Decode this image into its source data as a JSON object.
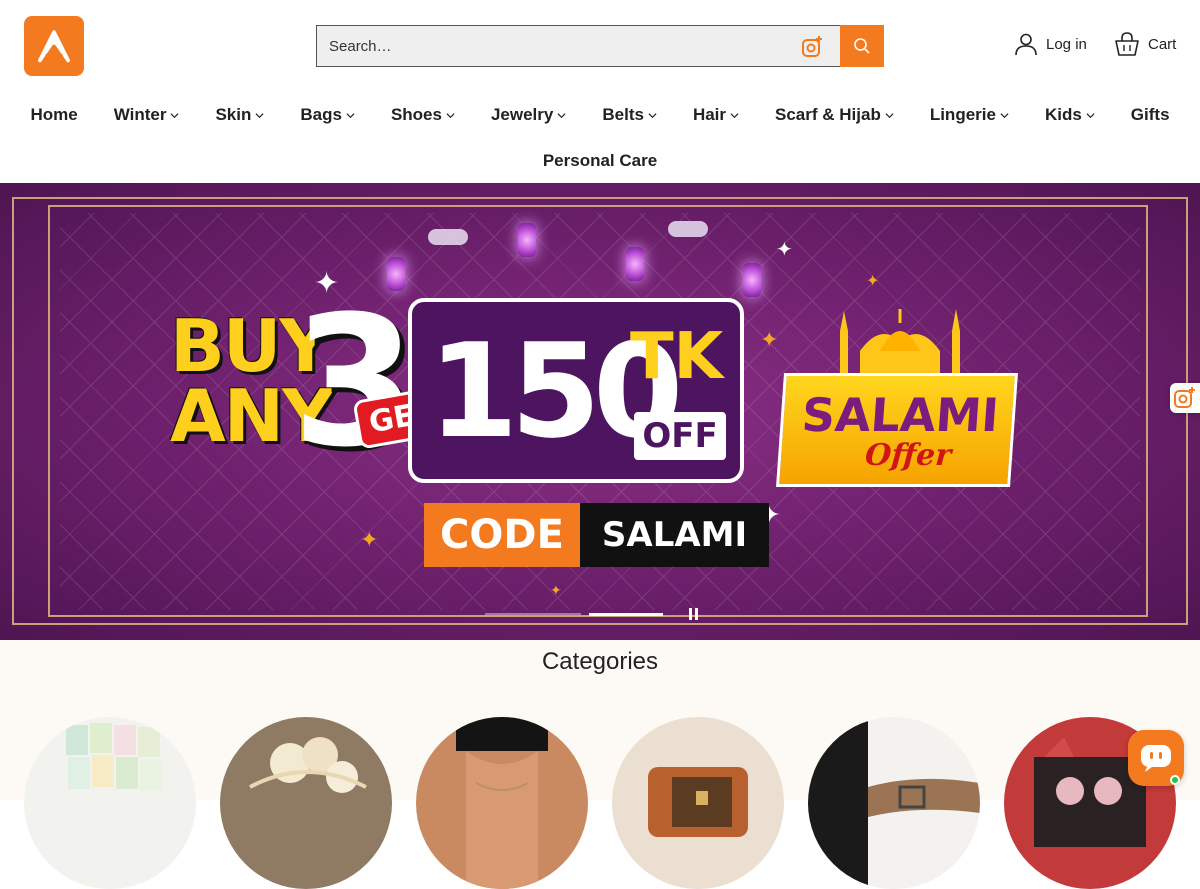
{
  "header": {
    "search_placeholder": "Search…",
    "login_label": "Log in",
    "cart_label": "Cart"
  },
  "nav": {
    "items": [
      {
        "label": "Home",
        "dropdown": false
      },
      {
        "label": "Winter",
        "dropdown": true
      },
      {
        "label": "Skin",
        "dropdown": true
      },
      {
        "label": "Bags",
        "dropdown": true
      },
      {
        "label": "Shoes",
        "dropdown": true
      },
      {
        "label": "Jewelry",
        "dropdown": true
      },
      {
        "label": "Belts",
        "dropdown": true
      },
      {
        "label": "Hair",
        "dropdown": true
      },
      {
        "label": "Scarf & Hijab",
        "dropdown": true
      },
      {
        "label": "Lingerie",
        "dropdown": true
      },
      {
        "label": "Kids",
        "dropdown": true
      },
      {
        "label": "Gifts",
        "dropdown": false
      },
      {
        "label": "Personal Care",
        "dropdown": false
      }
    ]
  },
  "banner": {
    "buy_line1": "BUY",
    "buy_line2": "ANY",
    "three": "3",
    "get": "GET",
    "amount": "150",
    "currency": "TK",
    "off": "OFF",
    "code_label": "CODE",
    "code_value": "SALAMI",
    "offer_word": "SALAMI",
    "offer_sub": "Offer",
    "slides_total": 2,
    "active_slide": 2
  },
  "categories": {
    "title": "Categories"
  },
  "colors": {
    "brand": "#f47a20",
    "banner_bg": "#6b1f6a",
    "accent_yellow": "#ffcf1e"
  }
}
